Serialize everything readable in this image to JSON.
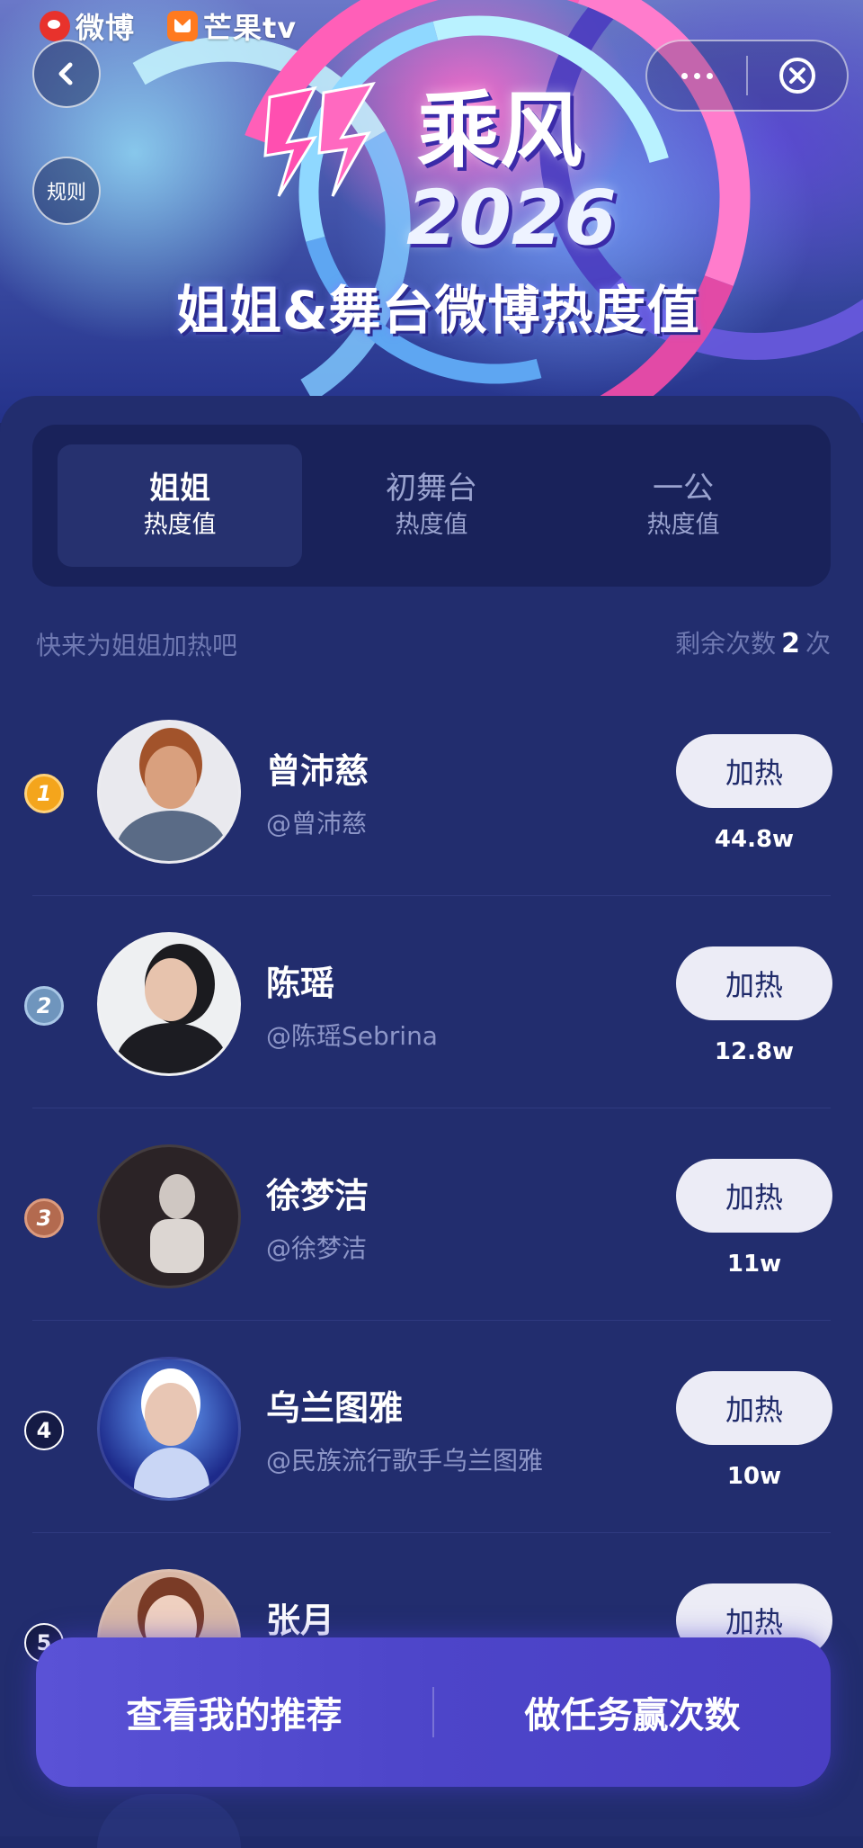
{
  "header": {
    "weibo_logo": "微博",
    "mango_logo": "芒果tv",
    "rules_label": "规则",
    "title_main": "乘风",
    "title_year": "2026",
    "title_sub": "姐姐&舞台微博热度值"
  },
  "icons": {
    "back": "chevron-left-icon",
    "more": "more-dots-icon",
    "close": "close-circle-icon"
  },
  "tabs": [
    {
      "label": "姐姐",
      "sub": "热度值",
      "active": true
    },
    {
      "label": "初舞台",
      "sub": "热度值",
      "active": false
    },
    {
      "label": "一公",
      "sub": "热度值",
      "active": false
    }
  ],
  "list_header": {
    "hint": "快来为姐姐加热吧",
    "remaining_prefix": "剩余次数",
    "remaining_count": "2",
    "remaining_suffix": "次"
  },
  "items": [
    {
      "rank": "1",
      "name": "曾沛慈",
      "handle": "@曾沛慈",
      "button": "加热",
      "score": "44.8w"
    },
    {
      "rank": "2",
      "name": "陈瑶",
      "handle": "@陈瑶Sebrina",
      "button": "加热",
      "score": "12.8w"
    },
    {
      "rank": "3",
      "name": "徐梦洁",
      "handle": "@徐梦洁",
      "button": "加热",
      "score": "11w"
    },
    {
      "rank": "4",
      "name": "乌兰图雅",
      "handle": "@民族流行歌手乌兰图雅",
      "button": "加热",
      "score": "10w"
    },
    {
      "rank": "5",
      "name": "张月",
      "handle": "",
      "button": "加热",
      "score": ""
    }
  ],
  "bottom_bar": {
    "left": "查看我的推荐",
    "right": "做任务赢次数"
  },
  "colors": {
    "background": "#1f2a6a",
    "panel": "#222d6e",
    "tab_container": "#19225a",
    "button": "#ececf6",
    "rank1": "#f4a51c",
    "rank2": "#6f95bd",
    "rank3": "#b36a4f",
    "bottom_bar": "#5a52d6"
  }
}
